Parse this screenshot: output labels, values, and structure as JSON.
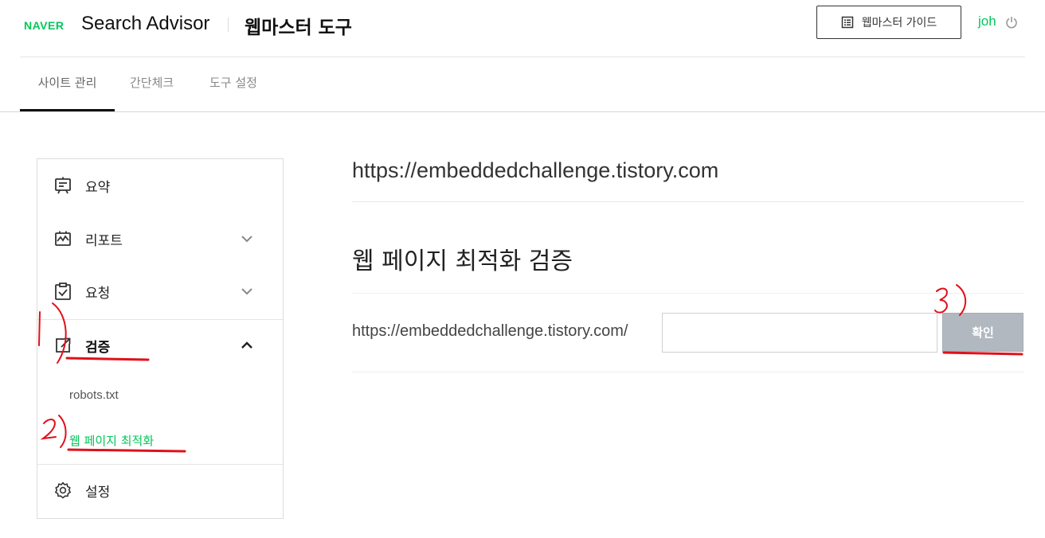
{
  "header": {
    "logo": "NAVER",
    "title": "Search Advisor",
    "subtitle": "웹마스터 도구",
    "guide_button_label": "웹마스터 가이드",
    "user": "joh"
  },
  "tabs": [
    {
      "label": "사이트 관리",
      "active": true
    },
    {
      "label": "간단체크",
      "active": false
    },
    {
      "label": "도구 설정",
      "active": false
    }
  ],
  "sidebar": {
    "items": [
      {
        "label": "요약",
        "icon": "summary-board-icon"
      },
      {
        "label": "리포트",
        "icon": "report-chart-icon",
        "chevron": "down"
      },
      {
        "label": "요청",
        "icon": "clipboard-check-icon",
        "chevron": "down"
      },
      {
        "label": "검증",
        "icon": "verify-edit-icon",
        "chevron": "up",
        "expanded": true
      },
      {
        "label": "설정",
        "icon": "gear-icon"
      }
    ],
    "sub_items": [
      {
        "label": "robots.txt",
        "active": false
      },
      {
        "label": "웹 페이지 최적화",
        "active": true
      }
    ]
  },
  "main": {
    "site_url": "https://embeddedchallenge.tistory.com",
    "page_title": "웹 페이지 최적화 검증",
    "form_url_prefix": "https://embeddedchallenge.tistory.com/",
    "path_input_value": "",
    "confirm_label": "확인"
  },
  "colors": {
    "brand_green": "#03c75a",
    "annotation_red": "#e0101a",
    "button_gray": "#b1b8c0"
  }
}
